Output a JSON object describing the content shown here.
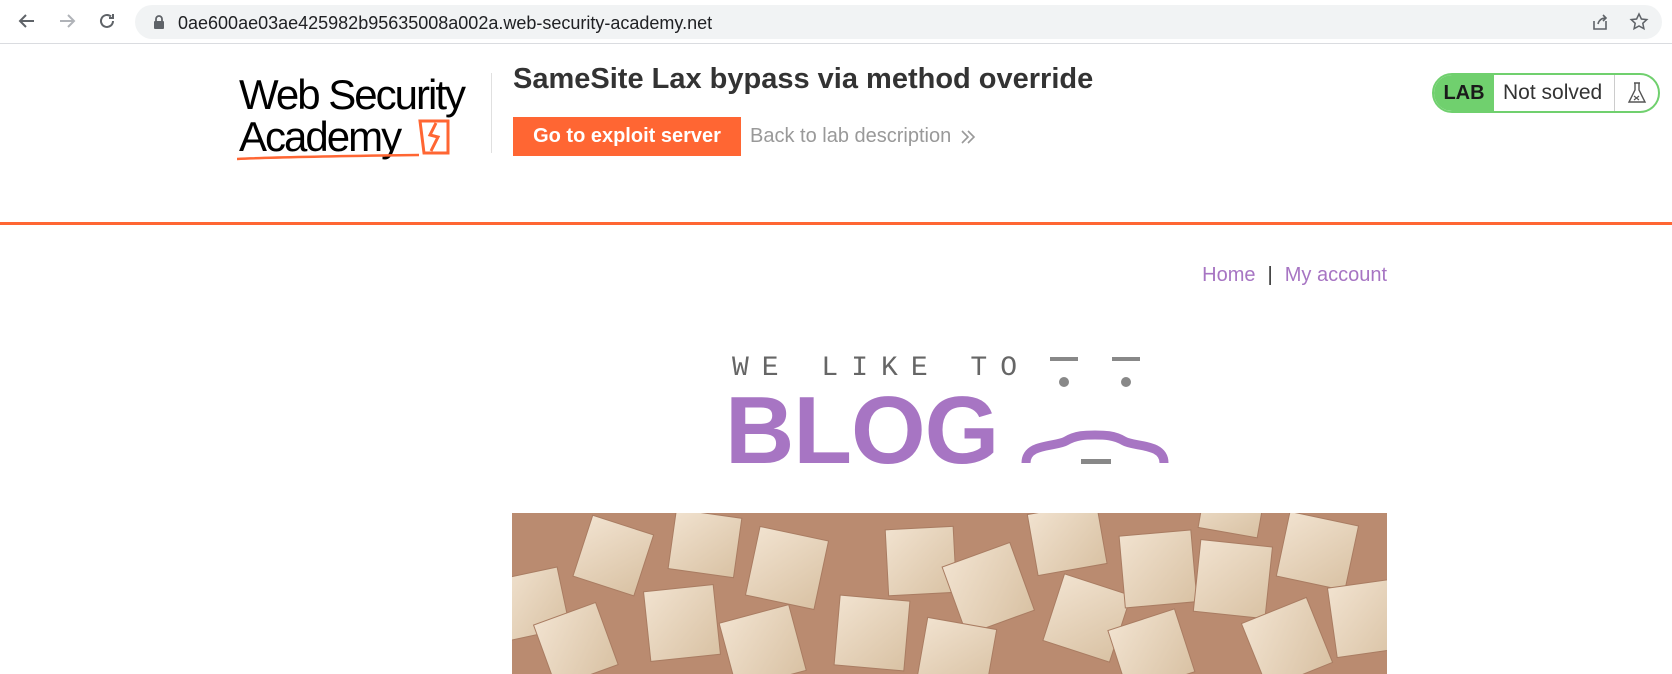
{
  "browser": {
    "url": "0ae600ae03ae425982b95635008a002a.web-security-academy.net",
    "back_icon": "arrow-left-icon",
    "forward_icon": "arrow-right-icon",
    "reload_icon": "reload-icon"
  },
  "lab": {
    "logo_text_line1": "Web Security",
    "logo_text_line2": "Academy",
    "title": "SameSite Lax bypass via method override",
    "exploit_button": "Go to exploit server",
    "back_link": "Back to lab description",
    "status_badge": "LAB",
    "status_text": "Not solved",
    "accent_color": "#ff6633",
    "status_color": "#70d06e"
  },
  "nav": {
    "home": "Home",
    "separator": "|",
    "my_account": "My account"
  },
  "banner": {
    "tagline": "WE LIKE TO",
    "word": "BLOG"
  }
}
